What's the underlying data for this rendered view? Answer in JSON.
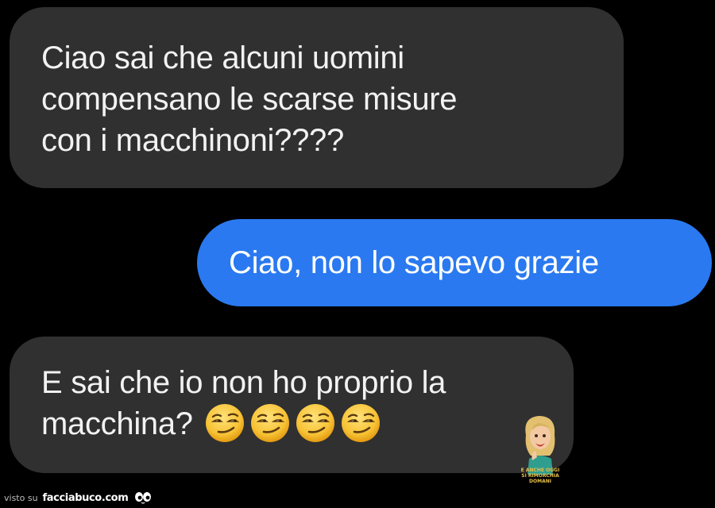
{
  "messages": [
    {
      "direction": "incoming",
      "lines": [
        "Ciao sai che alcuni uomini",
        "compensano le scarse misure",
        "con i macchinoni????"
      ]
    },
    {
      "direction": "outgoing",
      "lines": [
        "Ciao, non lo sapevo grazie"
      ]
    },
    {
      "direction": "incoming",
      "lines": [
        "E sai che io non ho proprio la",
        "macchina?"
      ],
      "emojis": [
        "smirking-face",
        "smirking-face",
        "smirking-face",
        "smirking-face"
      ]
    }
  ],
  "sticker": {
    "caption_lines": [
      "E anche oggi",
      "si rimorchia domani"
    ]
  },
  "watermark": {
    "prefix": "visto su",
    "site": "facciabuco.com"
  },
  "colors": {
    "background": "#000000",
    "incoming_bubble": "#303030",
    "outgoing_bubble": "#2a79f0",
    "text": "#f2f2f2"
  }
}
